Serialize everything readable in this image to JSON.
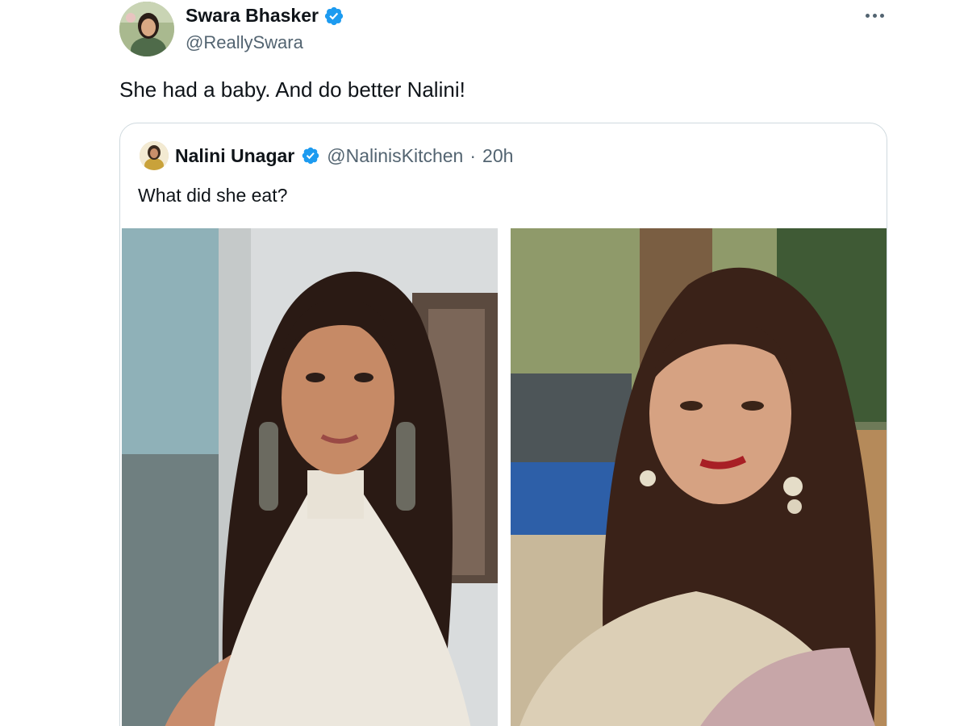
{
  "tweet": {
    "author": {
      "display_name": "Swara Bhasker",
      "handle": "@ReallySwara",
      "verified": true
    },
    "text": "She had a baby. And do better Nalini!",
    "more_icon": "more-horizontal-icon"
  },
  "quoted_tweet": {
    "author": {
      "display_name": "Nalini Unagar",
      "handle": "@NalinisKitchen",
      "verified": true
    },
    "separator": "·",
    "time": "20h",
    "text": "What did she eat?",
    "media_count": 2
  },
  "colors": {
    "verified": "#1d9bf0",
    "secondary_text": "#536471",
    "border": "#cfd9de"
  }
}
